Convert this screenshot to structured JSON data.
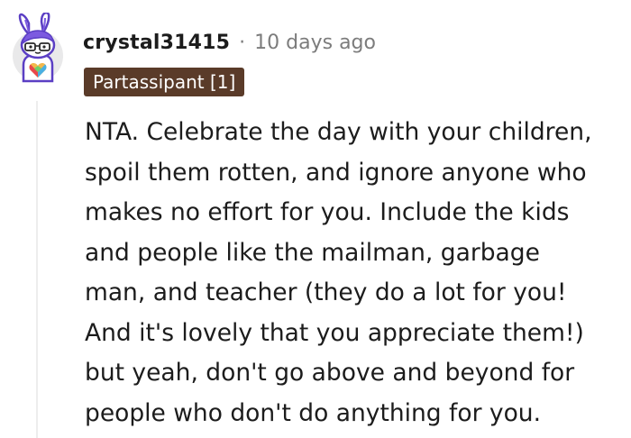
{
  "comment": {
    "author": "crystal31415",
    "separator": "·",
    "timestamp": "10 days ago",
    "flair": "Partassipant [1]",
    "avatar_icon": "snoo-avatar-icon",
    "flair_color": "#5a3b29",
    "body_lines": [
      "NTA. Celebrate the day with your children,",
      "spoil them rotten, and ignore anyone who",
      "makes no effort for you. Include the kids",
      "and people like the mailman, garbage",
      "man, and teacher (they do a lot for you!",
      "And it's lovely that you appreciate them!)",
      "but yeah, don't go above and beyond for",
      "people who don't do anything for you."
    ]
  }
}
